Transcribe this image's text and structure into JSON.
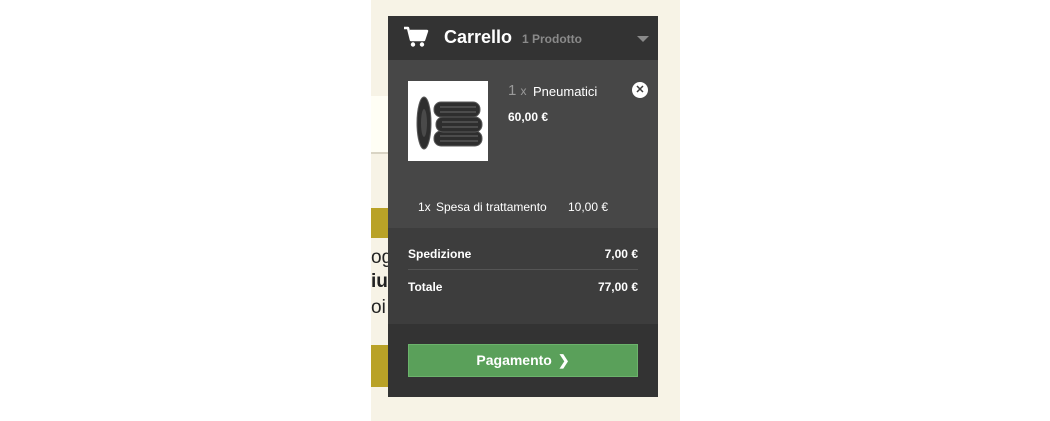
{
  "page_fragments": {
    "line1": "og",
    "line2": "iu",
    "line3": "oi"
  },
  "cart": {
    "title": "Carrello",
    "count_text": "1 Prodotto",
    "items": [
      {
        "qty": "1",
        "qty_suffix": "x",
        "name": "Pneumatici",
        "price": "60,00 €"
      }
    ],
    "fee": {
      "qty": "1x",
      "label": "Spesa di trattamento",
      "price": "10,00 €"
    },
    "shipping": {
      "label": "Spedizione",
      "value": "7,00 €"
    },
    "total": {
      "label": "Totale",
      "value": "77,00 €"
    },
    "checkout_label": "Pagamento",
    "remove_icon": "close-icon",
    "accent_color": "#5aa05a"
  }
}
